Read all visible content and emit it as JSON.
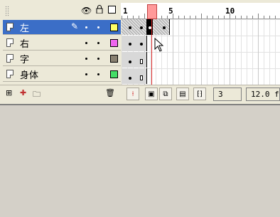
{
  "timeline": {
    "ruler_numbers": [
      "1",
      "5",
      "10"
    ],
    "layers": [
      {
        "name": "左",
        "selected": true,
        "color": "#ffff66",
        "editing": true
      },
      {
        "name": "右",
        "selected": false,
        "color": "#ee66ee"
      },
      {
        "name": "字",
        "selected": false,
        "color": "#888070"
      },
      {
        "name": "身体",
        "selected": false,
        "color": "#44dd66"
      }
    ],
    "current_frame": "3",
    "frame_rate": "12.0 f"
  },
  "icons": {
    "eye": "eye-icon",
    "lock": "lock-icon",
    "outline": "outline-icon",
    "pencil": "pencil-icon",
    "trash": "trash-icon"
  },
  "colors": {
    "selected": "#3b6ec7",
    "playhead": "#ff9a9a",
    "playhead_line": "#d02020"
  }
}
